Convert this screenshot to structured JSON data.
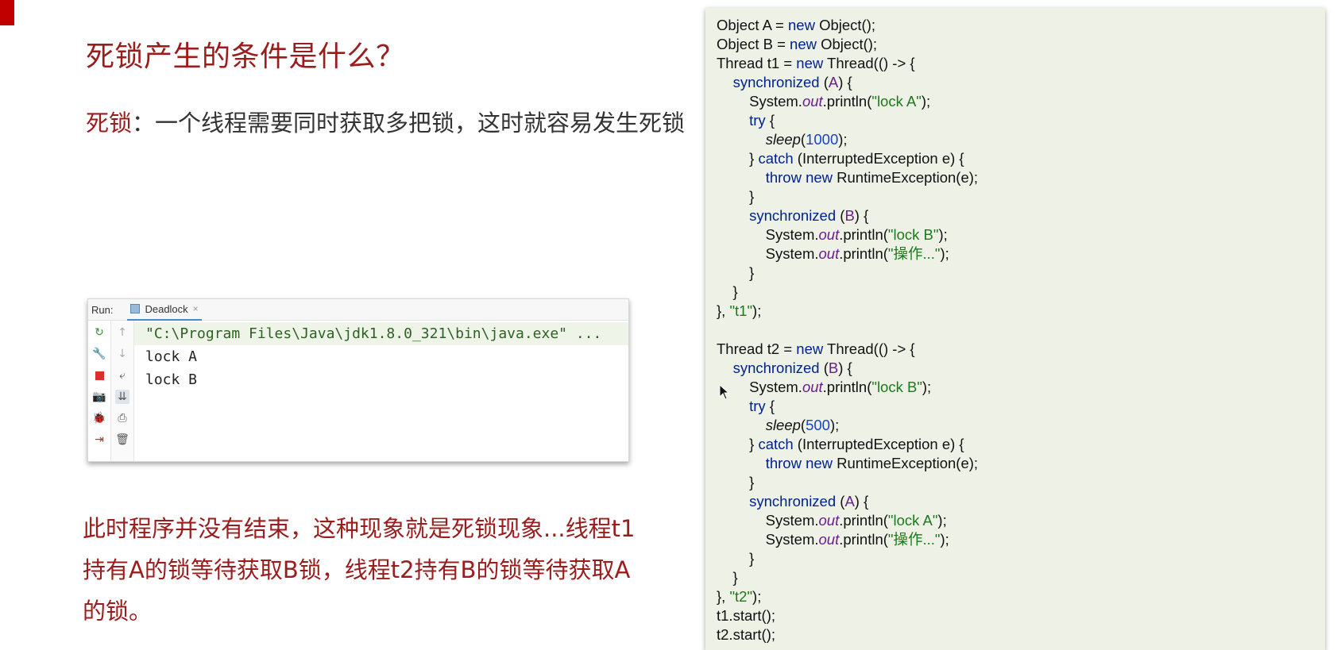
{
  "slide": {
    "title": "死锁产生的条件是什么？",
    "definition_term": "死锁",
    "definition_text": "：一个线程需要同时获取多把锁，这时就容易发生死锁",
    "explanation": "此时程序并没有结束，这种现象就是死锁现象...线程t1持有A的锁等待获取B锁，线程t2持有B的锁等待获取A的锁。",
    "accent_color": "#c00000",
    "title_color": "#9b1c1c"
  },
  "run_panel": {
    "label": "Run:",
    "tab_name": "Deadlock",
    "tab_close": "×",
    "console_lines": [
      "\"C:\\Program Files\\Java\\jdk1.8.0_321\\bin\\java.exe\" ...",
      "lock A",
      "lock B"
    ],
    "icons_left": [
      "rerun-icon",
      "wrench-icon",
      "stop-icon",
      "camera-icon",
      "debug-icon",
      "exit-icon"
    ],
    "icons_right": [
      "up-arrow-icon",
      "down-arrow-icon",
      "soft-wrap-icon",
      "scroll-to-end-icon",
      "print-icon",
      "trash-icon"
    ]
  },
  "code_panel": {
    "background": "#eef1e6"
  }
}
